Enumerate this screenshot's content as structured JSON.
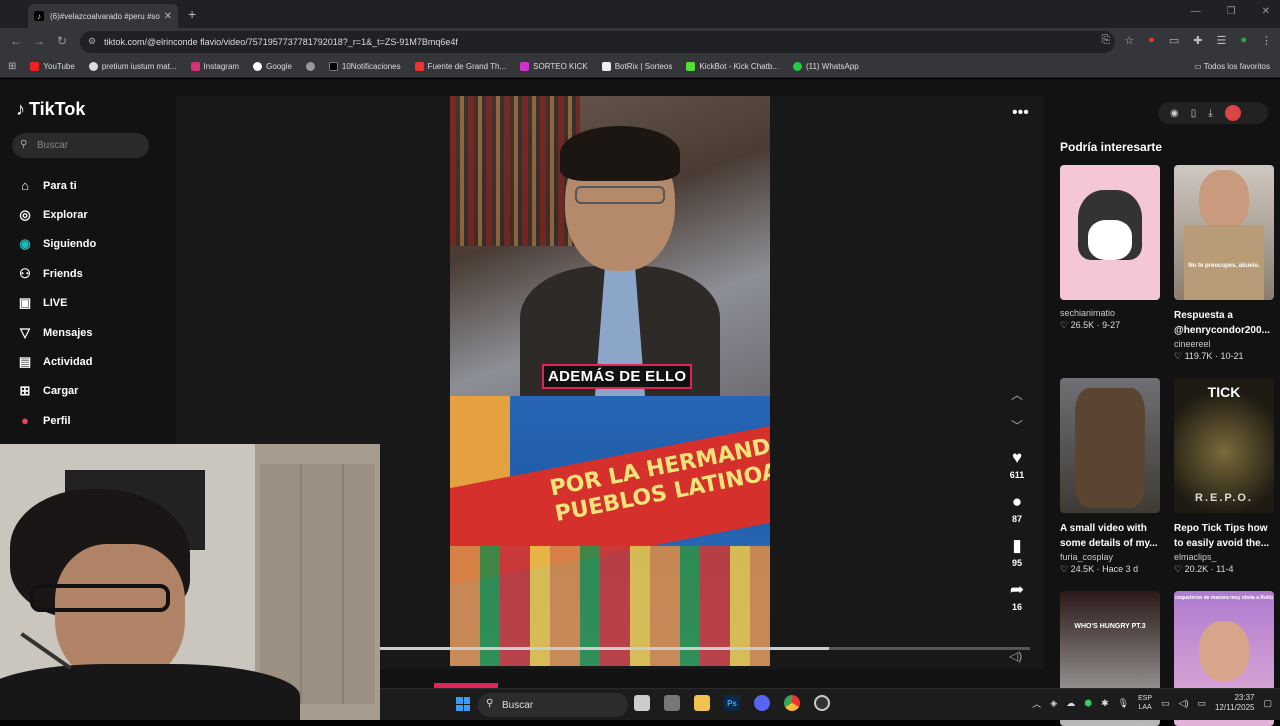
{
  "browser": {
    "tab_title": "(6)#velazcoalvarado #peru #so",
    "url": "tiktok.com/@elrinconde flavio/video/7571957737781792018?_r=1&_t=ZS-91M7Bmq6e4f",
    "bookmarks": [
      "YouTube",
      "pretium iustum mat...",
      "Instagram",
      "Google",
      "",
      "10Notificaciones",
      "Fuente de Grand Th...",
      "SORTEO KICK",
      "BotRix | Sorteos",
      "KickBot - Kick Chatb...",
      "(11) WhatsApp"
    ],
    "all_bookmarks": "Todos los favoritos"
  },
  "tiktok": {
    "brand": "TikTok",
    "search_placeholder": "Buscar",
    "nav": [
      {
        "label": "Para ti",
        "icon": "home-icon"
      },
      {
        "label": "Explorar",
        "icon": "compass-icon"
      },
      {
        "label": "Siguiendo",
        "icon": "following-icon"
      },
      {
        "label": "Friends",
        "icon": "friends-icon"
      },
      {
        "label": "LIVE",
        "icon": "live-icon"
      },
      {
        "label": "Mensajes",
        "icon": "send-icon"
      },
      {
        "label": "Actividad",
        "icon": "inbox-icon"
      },
      {
        "label": "Cargar",
        "icon": "upload-icon"
      },
      {
        "label": "Perfil",
        "icon": "profile-icon"
      }
    ],
    "video": {
      "caption": "ADEMÁS DE ELLO",
      "mural_text": "POR LA HERMANDAD E PUEBLOS LATINOAMERIC",
      "likes": "611",
      "comments": "87",
      "saves": "95",
      "shares": "16",
      "progress": 0.69
    },
    "suggestions_title": "Podría interesarte",
    "suggestions": [
      {
        "title": "",
        "user": "sechianimatio",
        "likes": "26.5K",
        "date": "9-27",
        "thumb_text": ""
      },
      {
        "title": "Respuesta a @henrycondor200...",
        "user": "cineereel",
        "likes": "119.7K",
        "date": "10-21",
        "thumb_text": "No te preocupes, abuelo."
      },
      {
        "title": "A small video with some details of my...",
        "user": "furia_cosplay",
        "likes": "24.5K",
        "date": "Hace 3 d",
        "thumb_text": ""
      },
      {
        "title": "Repo Tick Tips how to easily avoid the...",
        "user": "elmaclips_",
        "likes": "20.2K",
        "date": "11-4",
        "thumb_text": "TICK"
      },
      {
        "title": "",
        "user": "",
        "likes": "",
        "date": "",
        "thumb_text": "WHO'S HUNGRY PT.3"
      },
      {
        "title": "",
        "user": "",
        "likes": "",
        "date": "",
        "thumb_text": "coqueteron de manera muy obvia a Rollo"
      }
    ]
  },
  "taskbar": {
    "search": "Buscar",
    "lang": "ESP",
    "lang2": "LAA",
    "time": "23:37",
    "date": "12/11/2025"
  }
}
